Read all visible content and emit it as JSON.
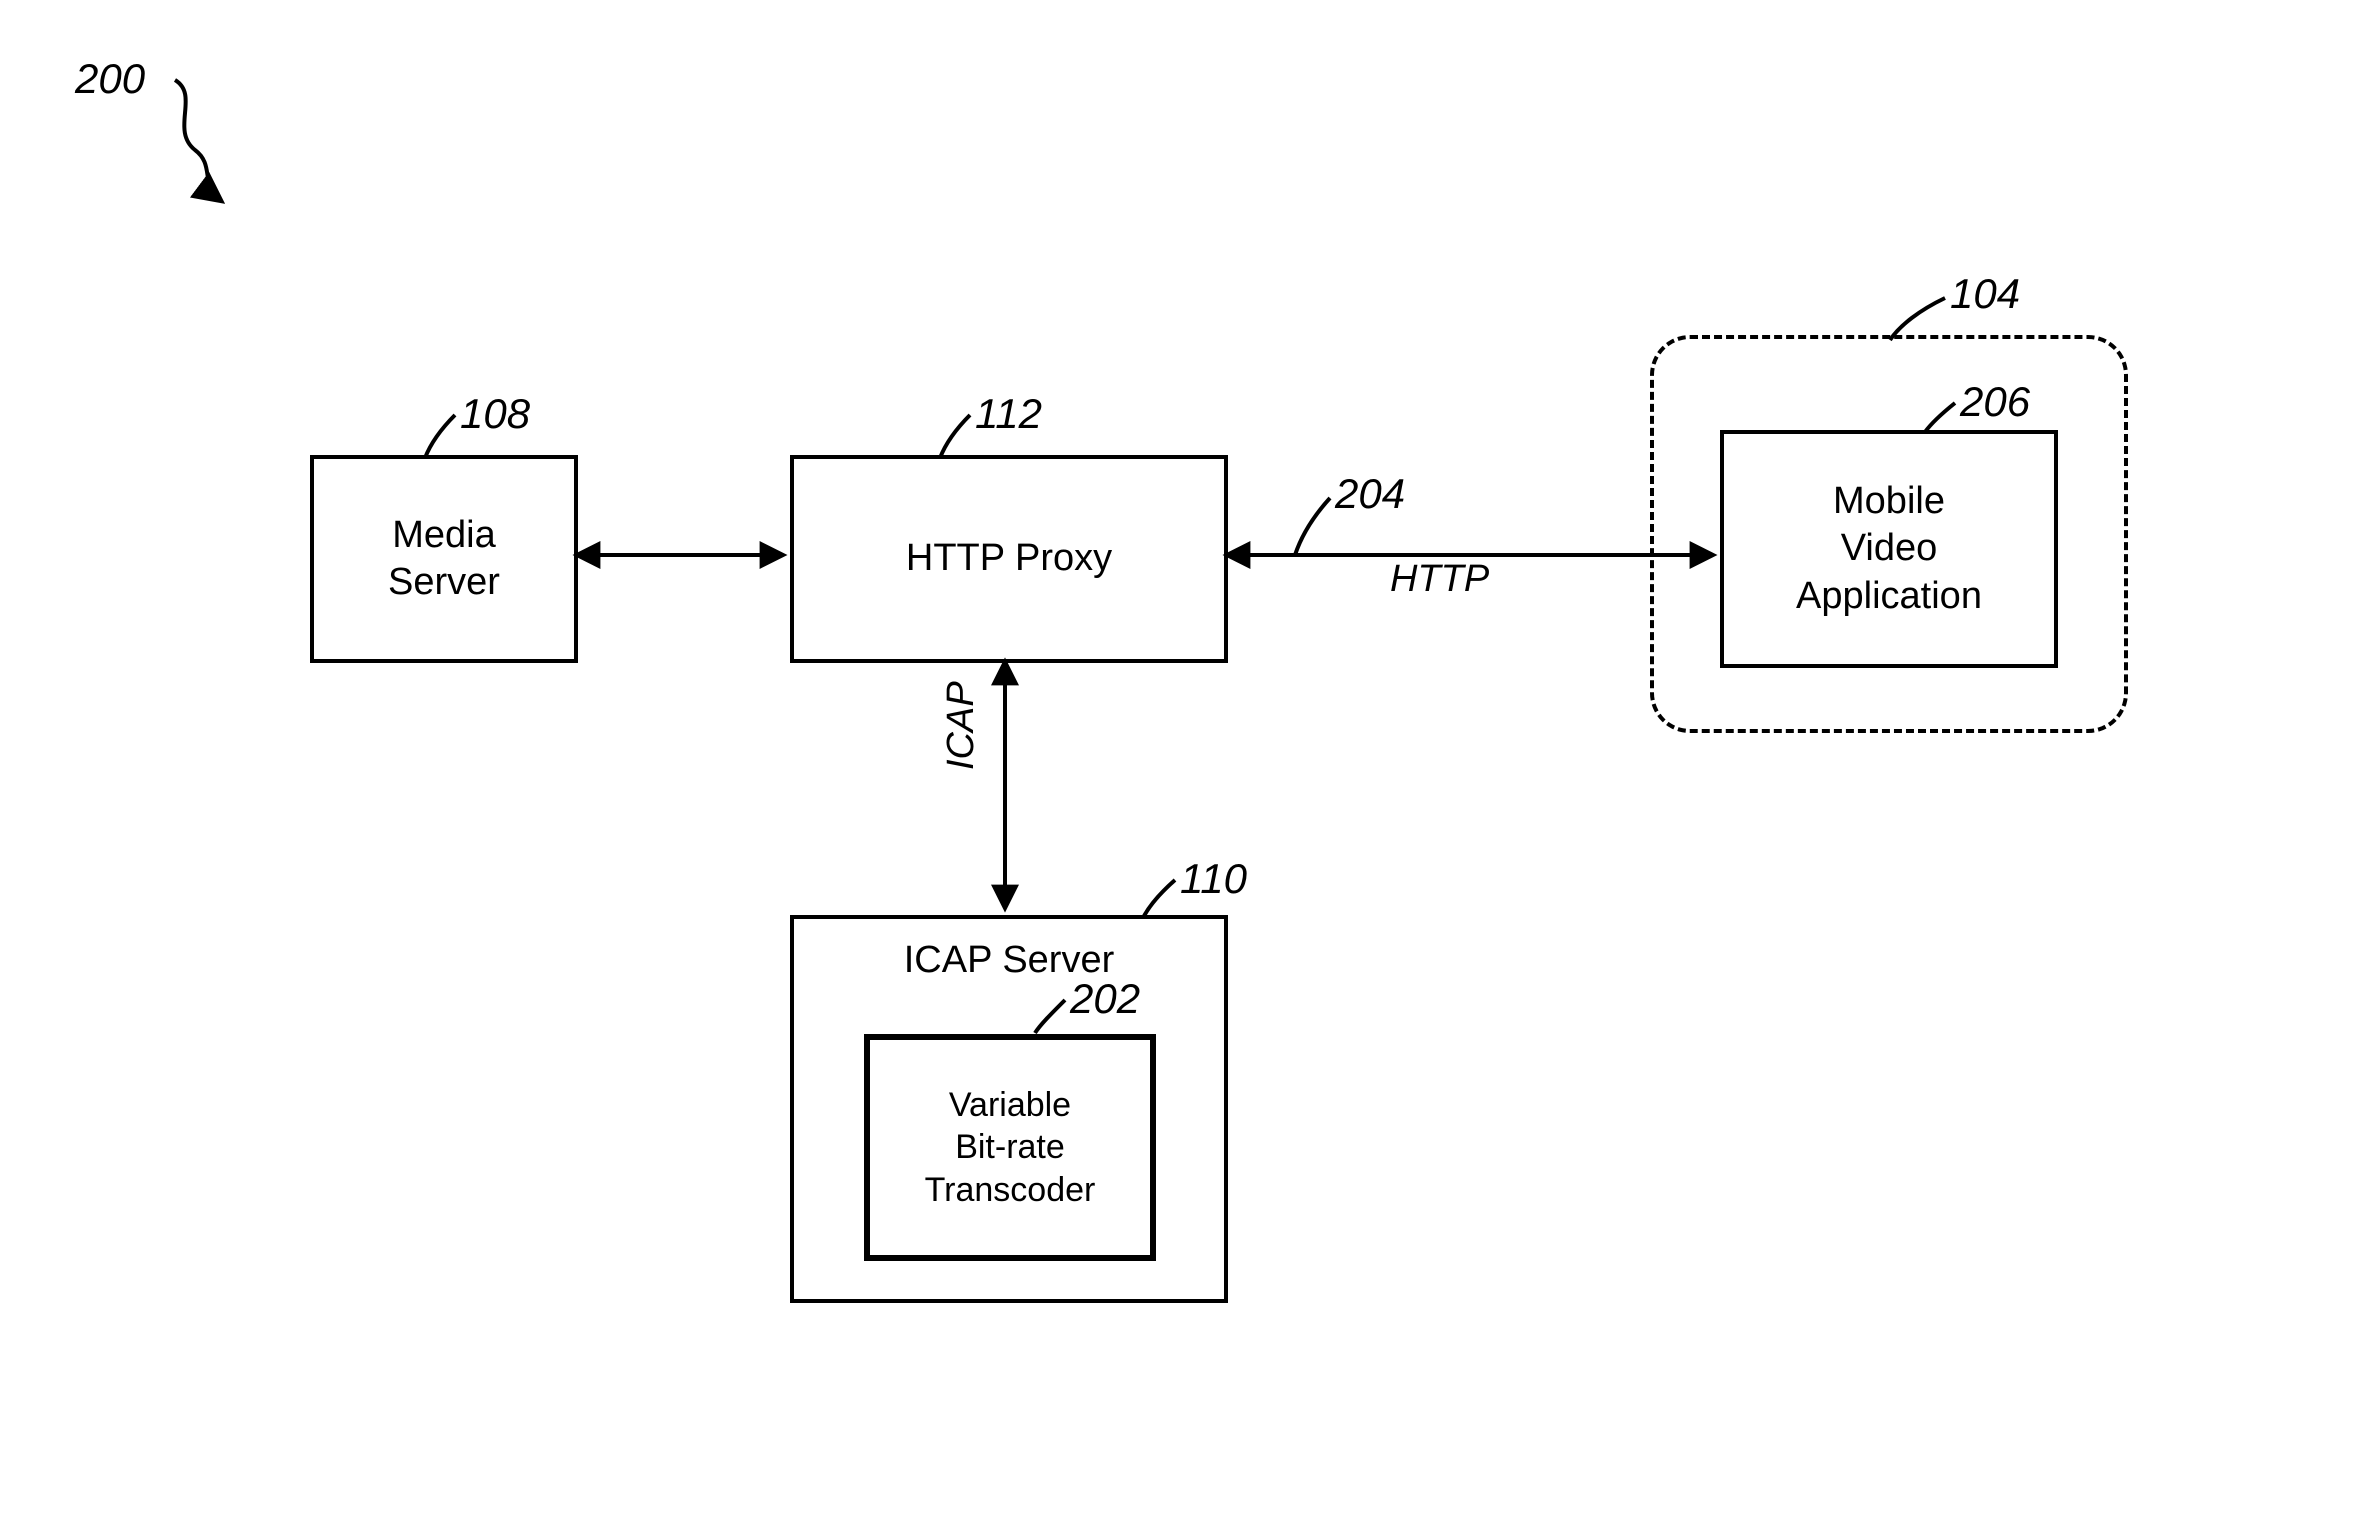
{
  "figure_ref": "200",
  "nodes": {
    "media_server": {
      "label": "Media\nServer",
      "ref": "108"
    },
    "http_proxy": {
      "label": "HTTP Proxy",
      "ref": "112"
    },
    "icap_server": {
      "label": "ICAP Server",
      "ref": "110"
    },
    "transcoder": {
      "label": "Variable\nBit-rate\nTranscoder",
      "ref": "202"
    },
    "mobile_group": {
      "ref": "104"
    },
    "mobile_app": {
      "label": "Mobile\nVideo\nApplication",
      "ref": "206"
    }
  },
  "edges": {
    "proxy_to_mobile": {
      "label": "HTTP",
      "ref": "204"
    },
    "proxy_to_icap": {
      "label": "ICAP"
    }
  }
}
